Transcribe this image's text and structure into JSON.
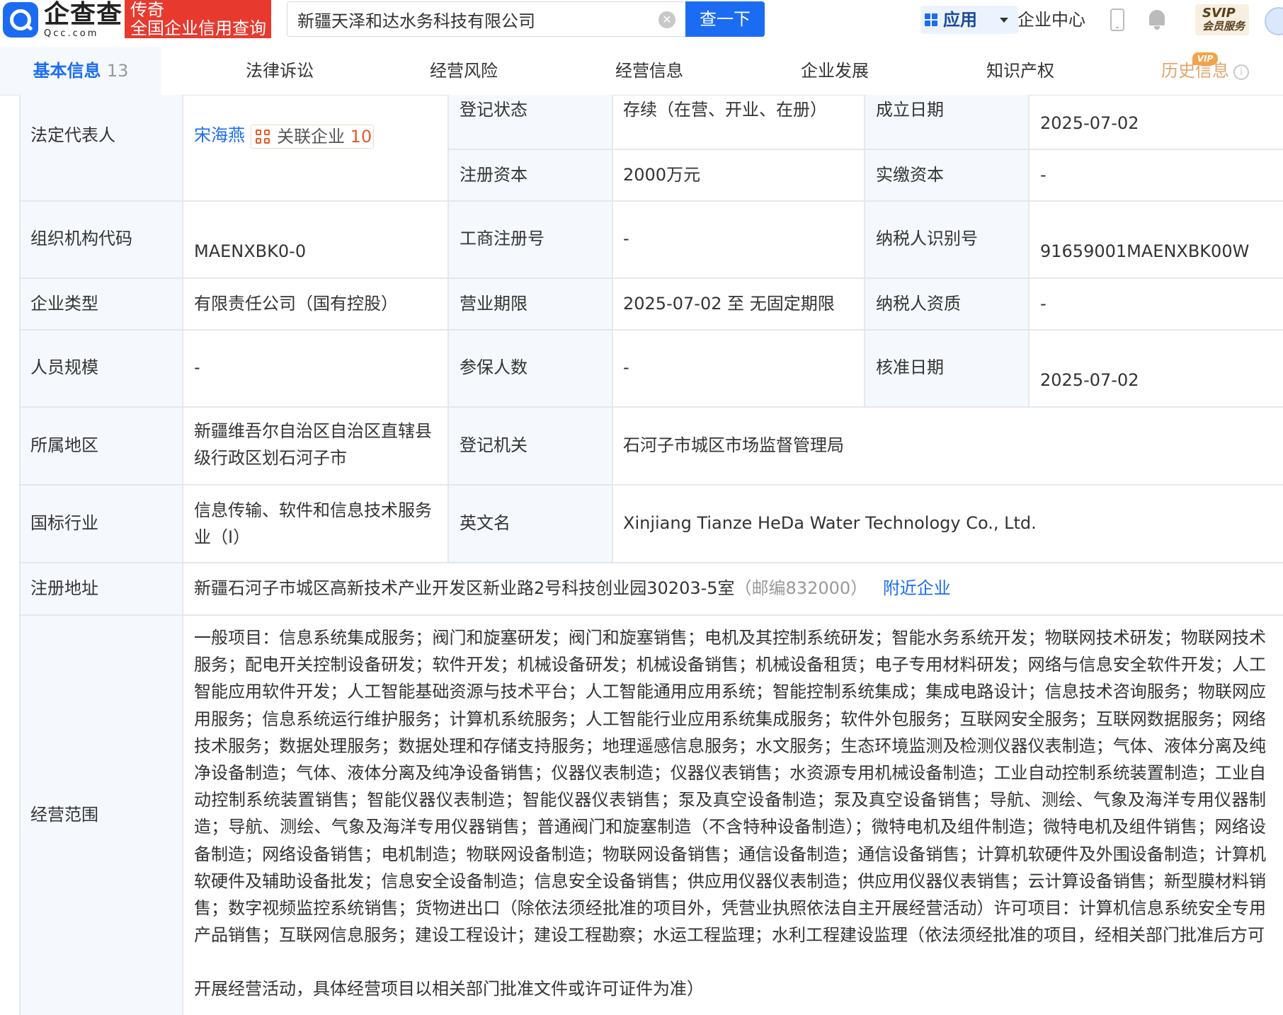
{
  "header": {
    "logo_cn": "企查查",
    "logo_en": "Qcc.com",
    "slogan_line1": "传奇",
    "slogan_line2": "全国企业信用查询",
    "search_value": "新疆天泽和达水务科技有限公司",
    "search_button": "查一下",
    "apps_label": "应用",
    "enterprise_center": "企业中心",
    "svip_line1": "SVIP",
    "svip_line2": "会员服务"
  },
  "tabs": [
    {
      "label": "基本信息",
      "count": "13"
    },
    {
      "label": "法律诉讼"
    },
    {
      "label": "经营风险"
    },
    {
      "label": "经营信息"
    },
    {
      "label": "企业发展"
    },
    {
      "label": "知识产权"
    },
    {
      "label": "历史信息"
    }
  ],
  "vip_badge": "VIP",
  "info": {
    "legal_rep_label": "法定代表人",
    "legal_rep_name": "宋海燕",
    "related_label": "关联企业",
    "related_count": "10",
    "reg_status_label": "登记状态",
    "reg_status_value": "存续（在营、开业、在册）",
    "found_date_label": "成立日期",
    "found_date_value": "2025-07-02",
    "reg_capital_label": "注册资本",
    "reg_capital_value": "2000万元",
    "paid_capital_label": "实缴资本",
    "paid_capital_value": "-",
    "org_code_label": "组织机构代码",
    "org_code_value": "MAENXBK0-0",
    "biz_reg_no_label": "工商注册号",
    "biz_reg_no_value": "-",
    "taxpayer_id_label": "纳税人识别号",
    "taxpayer_id_value": "91659001MAENXBK00W",
    "company_type_label": "企业类型",
    "company_type_value": "有限责任公司（国有控股）",
    "biz_term_label": "营业期限",
    "biz_term_value": "2025-07-02 至 无固定期限",
    "taxpayer_qual_label": "纳税人资质",
    "taxpayer_qual_value": "-",
    "staff_size_label": "人员规模",
    "staff_size_value": "-",
    "insured_label": "参保人数",
    "insured_value": "-",
    "approval_date_label": "核准日期",
    "approval_date_value": "2025-07-02",
    "region_label": "所属地区",
    "region_value_line1": "新疆维吾尔自治区自治区直辖县",
    "region_value_line2": "级行政区划石河子市",
    "reg_authority_label": "登记机关",
    "reg_authority_value": "石河子市城区市场监督管理局",
    "industry_label": "国标行业",
    "industry_value_line1": "信息传输、软件和信息技术服务",
    "industry_value_line2": "业（I）",
    "english_name_label": "英文名",
    "english_name_value": "Xinjiang Tianze HeDa Water Technology Co., Ltd.",
    "address_label": "注册地址",
    "address_value": "新疆石河子市城区高新技术产业开发区新业路2号科技创业园30203-5室",
    "postcode": "（邮编832000）",
    "nearby_link": "附近企业",
    "scope_label": "经营范围",
    "scope_value": "一般项目：信息系统集成服务；阀门和旋塞研发；阀门和旋塞销售；电机及其控制系统研发；智能水务系统开发；物联网技术研发；物联网技术服务；配电开关控制设备研发；软件开发；机械设备研发；机械设备销售；机械设备租赁；电子专用材料研发；网络与信息安全软件开发；人工智能应用软件开发；人工智能基础资源与技术平台；人工智能通用应用系统；智能控制系统集成；集成电路设计；信息技术咨询服务；物联网应用服务；信息系统运行维护服务；计算机系统服务；人工智能行业应用系统集成服务；软件外包服务；互联网安全服务；互联网数据服务；网络技术服务；数据处理服务；数据处理和存储支持服务；地理遥感信息服务；水文服务；生态环境监测及检测仪器仪表制造；气体、液体分离及纯净设备制造；气体、液体分离及纯净设备销售；仪器仪表制造；仪器仪表销售；水资源专用机械设备制造；工业自动控制系统装置制造；工业自动控制系统装置销售；智能仪器仪表制造；智能仪器仪表销售；泵及真空设备制造；泵及真空设备销售；导航、测绘、气象及海洋专用仪器制造；导航、测绘、气象及海洋专用仪器销售；普通阀门和旋塞制造（不含特种设备制造）；微特电机及组件制造；微特电机及组件销售；网络设备制造；网络设备销售；电机制造；物联网设备制造；物联网设备销售；通信设备制造；通信设备销售；计算机软硬件及外围设备制造；计算机软硬件及辅助设备批发；信息安全设备制造；信息安全设备销售；供应用仪器仪表制造；供应用仪器仪表销售；云计算设备销售；新型膜材料销售；数字视频监控系统销售；货物进出口（除依法须经批准的项目外，凭营业执照依法自主开展经营活动）许可项目：计算机信息系统安全专用产品销售；互联网信息服务；建设工程设计；建设工程勘察；水运工程监理；水利工程建设监理（依法须经批准的项目，经相关部门批准后方可",
    "scope_tail": "开展经营活动，具体经营项目以相关部门批准文件或许可证件为准）"
  },
  "colors": {
    "brand_blue": "#1b6cf2",
    "slogan_red": "#e8392e",
    "label_bg": "#f5f8fd",
    "history_orange": "#e0a56e",
    "related_orange": "#e55a2b"
  }
}
